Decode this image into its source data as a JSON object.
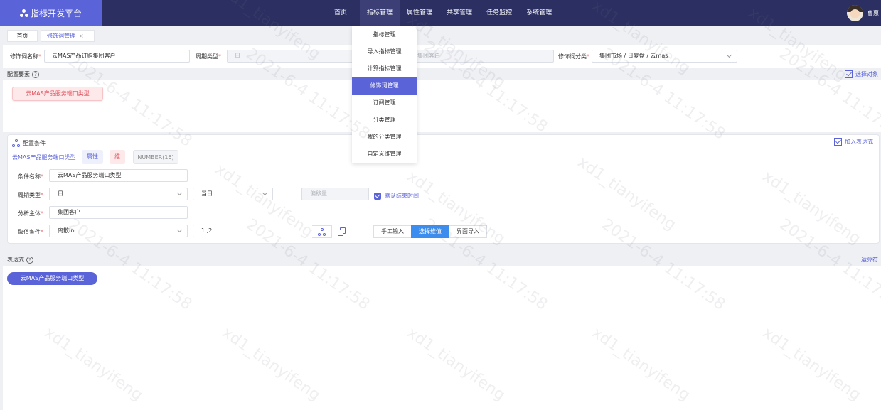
{
  "app": {
    "title": "指标开发平台",
    "username": "曹惠"
  },
  "nav": {
    "items": [
      {
        "label": "首页"
      },
      {
        "label": "指标管理"
      },
      {
        "label": "属性管理"
      },
      {
        "label": "共享管理"
      },
      {
        "label": "任务监控"
      },
      {
        "label": "系统管理"
      }
    ]
  },
  "dropdown": {
    "items": [
      {
        "label": "指标管理"
      },
      {
        "label": "导入指标管理"
      },
      {
        "label": "计算指标管理"
      },
      {
        "label": "修饰词管理"
      },
      {
        "label": "订阅管理"
      },
      {
        "label": "分类管理"
      },
      {
        "label": "我的分类管理"
      },
      {
        "label": "自定义维管理"
      }
    ],
    "active": "修饰词管理"
  },
  "tabs": {
    "home": "首页",
    "active": "修饰词管理",
    "close": "×"
  },
  "filter": {
    "name_label": "修饰词名称",
    "name_value": "云MAS产品订购集团客户",
    "period_label": "周期类型",
    "period_value": "日",
    "subject_value": "集团客户",
    "category_label": "修饰词分类",
    "category_value": "集团市场 / 日复盘 / 云mas",
    "required_mark": "*"
  },
  "config_element": {
    "title": "配置要素",
    "help": "?",
    "select_object": "选择对象",
    "tag": "云MAS产品服务端口类型"
  },
  "config_condition": {
    "title": "配置条件",
    "add_expression": "加入表达式",
    "field_name": "云MAS产品服务端口类型",
    "chip_attr": "属性",
    "chip_dim": "维",
    "chip_type": "NUMBER(16)",
    "rows": {
      "cond_name_label": "条件名称",
      "cond_name_value": "云MAS产品服务端口类型",
      "period_label": "周期类型",
      "period_value": "日",
      "period_sub_value": "当日",
      "offset_placeholder": "偏移量",
      "default_end_time": "默认结束时间",
      "subject_label": "分析主体",
      "subject_value": "集团客户",
      "value_cond_label": "取值条件",
      "value_cond_value": "离散in",
      "value_input": "1 ,2"
    },
    "modes": [
      {
        "label": "手工输入",
        "active": false
      },
      {
        "label": "选择维值",
        "active": true
      },
      {
        "label": "界面导入",
        "active": false
      }
    ]
  },
  "expression": {
    "title": "表达式",
    "help": "?",
    "operator": "运算符",
    "tag": "云MAS产品服务端口类型"
  },
  "watermark": {
    "line1": "xd1_tianyifeng",
    "line2": "2021-6-4 11:17:58"
  },
  "colors": {
    "nav_bg": "#2b2f61",
    "brand": "#5b63d8",
    "accent": "#5b63d8",
    "danger": "#e0505c"
  }
}
